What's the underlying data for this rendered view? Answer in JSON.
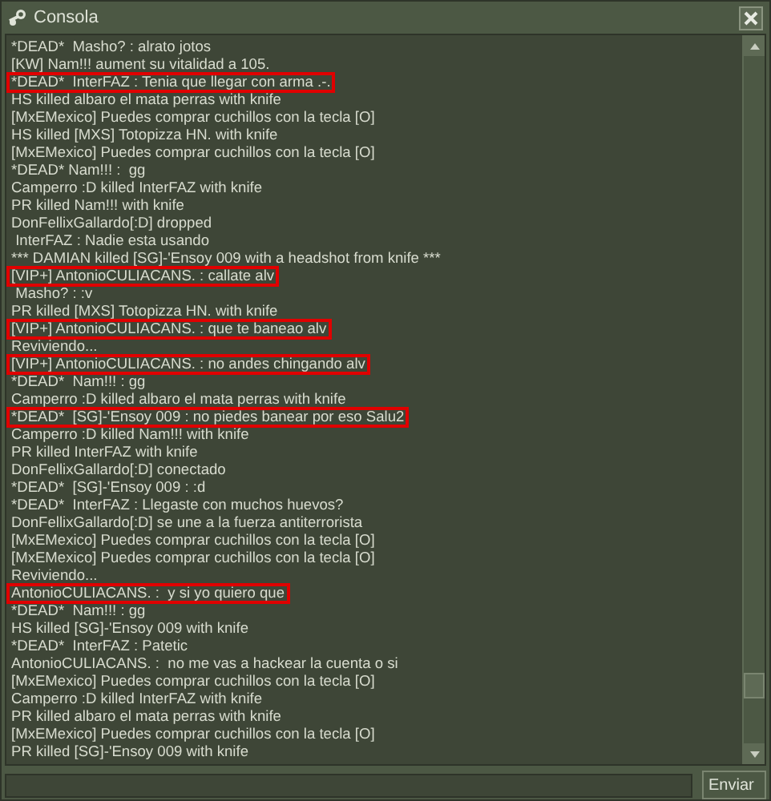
{
  "window": {
    "title": "Consola"
  },
  "log": [
    {
      "text": "*DEAD*  Masho? : alrato jotos",
      "highlighted": false
    },
    {
      "text": "[KW] Nam!!! aument su vitalidad a 105.",
      "highlighted": false
    },
    {
      "text": "*DEAD*  InterFAZ : Tenia que llegar con arma .-.",
      "highlighted": true
    },
    {
      "text": "HS killed albaro el mata perras with knife",
      "highlighted": false
    },
    {
      "text": "[MxEMexico] Puedes comprar cuchillos con la tecla [O]",
      "highlighted": false
    },
    {
      "text": "HS killed [MXS] Totopizza HN. with knife",
      "highlighted": false
    },
    {
      "text": "[MxEMexico] Puedes comprar cuchillos con la tecla [O]",
      "highlighted": false
    },
    {
      "text": "*DEAD* Nam!!! :  gg",
      "highlighted": false
    },
    {
      "text": "Camperro :D killed InterFAZ with knife",
      "highlighted": false
    },
    {
      "text": "PR killed Nam!!! with knife",
      "highlighted": false
    },
    {
      "text": "DonFellixGallardo[:D] dropped",
      "highlighted": false
    },
    {
      "text": " InterFAZ : Nadie esta usando",
      "highlighted": false
    },
    {
      "text": "*** DAMIAN killed [SG]-'Ensoy 009 with a headshot from knife ***",
      "highlighted": false
    },
    {
      "text": "[VIP+] AntonioCULIACANS. : callate alv",
      "highlighted": true
    },
    {
      "text": " Masho? : :v",
      "highlighted": false
    },
    {
      "text": "PR killed [MXS] Totopizza HN. with knife",
      "highlighted": false
    },
    {
      "text": "[VIP+] AntonioCULIACANS. : que te baneao alv",
      "highlighted": true
    },
    {
      "text": "Reviviendo...",
      "highlighted": false
    },
    {
      "text": "[VIP+] AntonioCULIACANS. : no andes chingando alv",
      "highlighted": true
    },
    {
      "text": "*DEAD*  Nam!!! : gg",
      "highlighted": false
    },
    {
      "text": "Camperro :D killed albaro el mata perras with knife",
      "highlighted": false
    },
    {
      "text": "*DEAD*  [SG]-'Ensoy 009 : no piedes banear por eso Salu2",
      "highlighted": true
    },
    {
      "text": "Camperro :D killed Nam!!! with knife",
      "highlighted": false
    },
    {
      "text": "PR killed InterFAZ with knife",
      "highlighted": false
    },
    {
      "text": "DonFellixGallardo[:D] conectado",
      "highlighted": false
    },
    {
      "text": "*DEAD*  [SG]-'Ensoy 009 : :d",
      "highlighted": false
    },
    {
      "text": "*DEAD*  InterFAZ : Llegaste con muchos huevos?",
      "highlighted": false
    },
    {
      "text": "DonFellixGallardo[:D] se une a la fuerza antiterrorista",
      "highlighted": false
    },
    {
      "text": "[MxEMexico] Puedes comprar cuchillos con la tecla [O]",
      "highlighted": false
    },
    {
      "text": "[MxEMexico] Puedes comprar cuchillos con la tecla [O]",
      "highlighted": false
    },
    {
      "text": "Reviviendo...",
      "highlighted": false
    },
    {
      "text": "AntonioCULIACANS. :  y si yo quiero que",
      "highlighted": true
    },
    {
      "text": "*DEAD*  Nam!!! : gg",
      "highlighted": false
    },
    {
      "text": "HS killed [SG]-'Ensoy 009 with knife",
      "highlighted": false
    },
    {
      "text": "*DEAD*  InterFAZ : Patetic",
      "highlighted": false
    },
    {
      "text": "AntonioCULIACANS. :  no me vas a hackear la cuenta o si",
      "highlighted": false
    },
    {
      "text": "[MxEMexico] Puedes comprar cuchillos con la tecla [O]",
      "highlighted": false
    },
    {
      "text": "Camperro :D killed InterFAZ with knife",
      "highlighted": false
    },
    {
      "text": "PR killed albaro el mata perras with knife",
      "highlighted": false
    },
    {
      "text": "[MxEMexico] Puedes comprar cuchillos con la tecla [O]",
      "highlighted": false
    },
    {
      "text": "PR killed [SG]-'Ensoy 009 with knife",
      "highlighted": false
    }
  ],
  "send_button": {
    "label": "Enviar"
  }
}
